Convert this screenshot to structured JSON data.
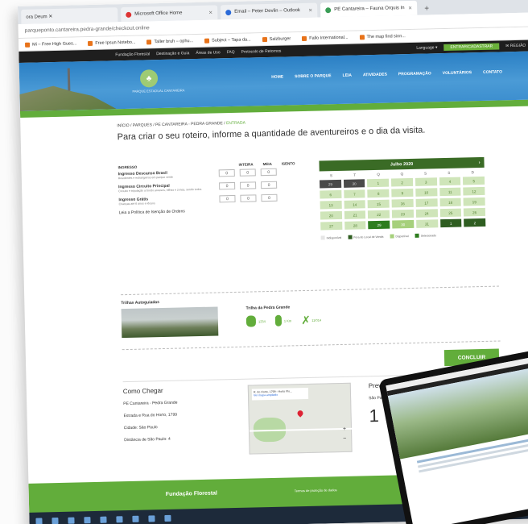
{
  "browser": {
    "tabs": [
      {
        "title": "ora Deum ✕"
      },
      {
        "title": "Microsoft Office Home"
      },
      {
        "title": "Email – Peter Devlin – Outlook"
      },
      {
        "title": "PE Cantareira – Fauna Orquis In"
      }
    ],
    "address": "parqueponto.cantareira.pedra-grande/checkout.online",
    "bookmarks": [
      "Mi – Free High Gues...",
      "Free Ipsun Notebo...",
      "Taller bruh – ophu...",
      "Subject – Tapa da...",
      "Salzburger",
      "Fallo International...",
      "The map find sinn..."
    ]
  },
  "site": {
    "topbar": {
      "links": [
        "Fundação Florestal",
        "Destinação e Guia",
        "Áreas de Uso",
        "FAQ",
        "Protocolo de Retornos"
      ],
      "lang": "Language ▾",
      "cta": "ENTRAR/CADASTRAR",
      "cart": "✉ REGIÃO"
    },
    "logo_text": "PARQUE ESTADUAL CANTAREIRA",
    "nav": [
      "HOME",
      "SOBRE O PARQUE",
      "LEIA",
      "ATIVIDADES",
      "PROGRAMAÇÃO",
      "VOLUNTÁRIOS",
      "CONTATO"
    ],
    "breadcrumb": {
      "path": "INÍCIO / PARQUES / PE CANTAREIRA - PEDRA GRANDE /",
      "current": "ENTRADA"
    },
    "heading": "Para criar o seu roteiro, informe a quantidade de aventureiros e o dia da visita.",
    "tickets": {
      "headers": [
        "INGRESSO",
        "INTEIRA",
        "MEIA",
        "ISENTO"
      ],
      "rows": [
        {
          "name": "Ingresso Descanso Brasil",
          "note": "Residentes e estrangeiros em parque verde",
          "vals": [
            "0",
            "0",
            "0"
          ]
        },
        {
          "name": "Ingresso Circuito Principal",
          "note": "Circuito e tripulação a bordo acessos, trilhas e zonas, sendo todos",
          "vals": [
            "0",
            "0",
            "0"
          ]
        },
        {
          "name": "Ingresso Grátis",
          "note": "Crianças até 6 anos e idosos",
          "vals": [
            "0",
            "0",
            "0"
          ]
        }
      ],
      "policy": "Leia a Política de Isenção de Ordens"
    },
    "calendar": {
      "month": "Julho 2020",
      "next": "›",
      "dow": [
        "S",
        "T",
        "Q",
        "Q",
        "S",
        "S",
        "D"
      ],
      "days": [
        {
          "n": "29",
          "t": "u"
        },
        {
          "n": "30",
          "t": "u"
        },
        {
          "n": "1",
          "t": "a"
        },
        {
          "n": "2",
          "t": "a"
        },
        {
          "n": "3",
          "t": "a"
        },
        {
          "n": "4",
          "t": "a"
        },
        {
          "n": "5",
          "t": "a"
        },
        {
          "n": "6",
          "t": "a"
        },
        {
          "n": "7",
          "t": "a"
        },
        {
          "n": "8",
          "t": "a"
        },
        {
          "n": "9",
          "t": "a"
        },
        {
          "n": "10",
          "t": "a"
        },
        {
          "n": "11",
          "t": "a"
        },
        {
          "n": "12",
          "t": "a"
        },
        {
          "n": "13",
          "t": "a"
        },
        {
          "n": "14",
          "t": "a"
        },
        {
          "n": "15",
          "t": "a"
        },
        {
          "n": "16",
          "t": "a"
        },
        {
          "n": "17",
          "t": "a"
        },
        {
          "n": "18",
          "t": "a"
        },
        {
          "n": "19",
          "t": "a"
        },
        {
          "n": "20",
          "t": "a"
        },
        {
          "n": "21",
          "t": "a"
        },
        {
          "n": "22",
          "t": "a"
        },
        {
          "n": "23",
          "t": "a"
        },
        {
          "n": "24",
          "t": "a"
        },
        {
          "n": "25",
          "t": "a"
        },
        {
          "n": "26",
          "t": "a"
        },
        {
          "n": "27",
          "t": "a"
        },
        {
          "n": "28",
          "t": "a"
        },
        {
          "n": "29",
          "t": "s"
        },
        {
          "n": "30",
          "t": "r"
        },
        {
          "n": "31",
          "t": "a"
        },
        {
          "n": "1",
          "t": "n"
        },
        {
          "n": "2",
          "t": "n"
        }
      ],
      "legend": [
        "Indisponível",
        "Fora do Local de Venda",
        "Disponível",
        "Selecionado"
      ]
    },
    "trails": {
      "title": "Trilhas Autoguiadas",
      "avail_title": "Trilha da Pedra Grande",
      "icons": [
        "1234",
        "1 Km",
        "11/014"
      ]
    },
    "conclude": "CONCLUIR",
    "footer_info": {
      "title": "Como Chegar",
      "lines": [
        "PE Cantareira - Pedra Grande",
        "Estrada e Rua do Horto, 1799",
        "Cidade: São Paulo",
        "Distância de São Paulo: 4"
      ],
      "map_card": "R. do Horto, 1799 - Horto Flo...",
      "map_link": "Ver mapa ampliado",
      "forecast_title": "Previsão do Tempo",
      "forecast_city": "São Pa...",
      "forecast_temp": "1"
    },
    "footer": {
      "left": "Fundação Florestal",
      "right": "Termos de proteção de dados"
    }
  },
  "colors": {
    "green": "#62ad3b",
    "dark_green": "#3a6b25",
    "sky": "#2a7fc4"
  }
}
